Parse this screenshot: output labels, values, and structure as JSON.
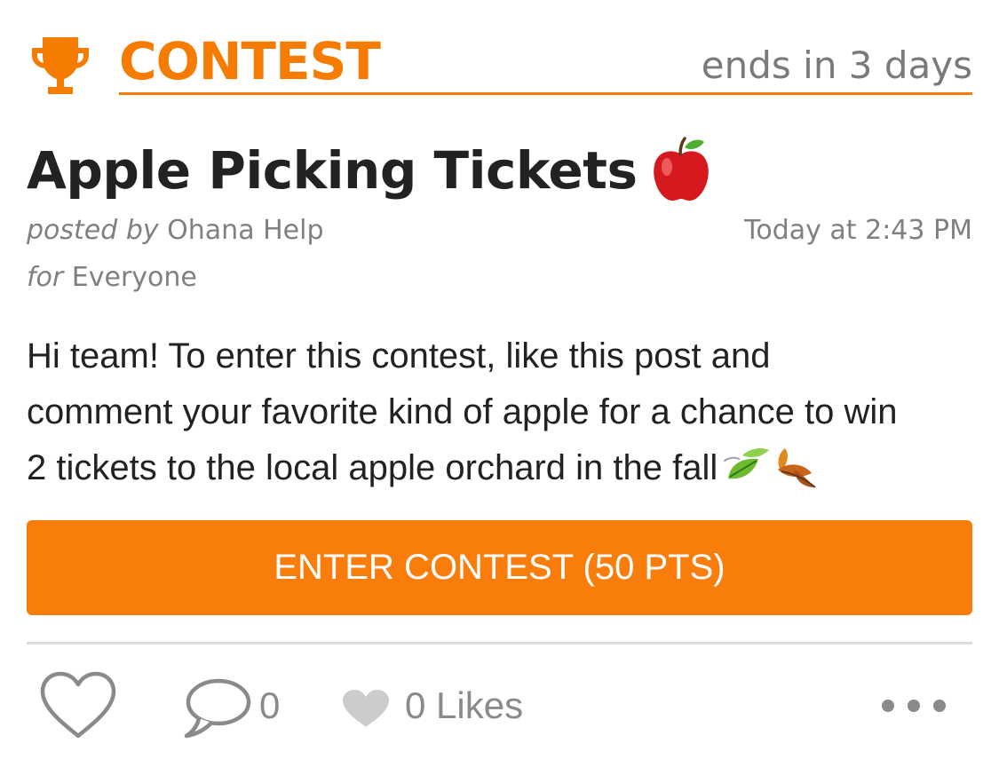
{
  "header": {
    "contest_label": "CONTEST",
    "ends_text": "ends in 3 days",
    "trophy_icon": "trophy-icon"
  },
  "post": {
    "title": "Apple Picking Tickets",
    "title_emoji": "red-apple-emoji",
    "posted_by_label": "posted by",
    "author": "Ohana Help",
    "timestamp": "Today at 2:43 PM",
    "for_label": "for",
    "audience": "Everyone",
    "body_line_1": "Hi team! To enter this contest, like this post and",
    "body_line_2": "comment your favorite kind of apple for a chance to win",
    "body_line_3": "2 tickets to the local apple orchard in the fall",
    "body_emojis": [
      "leaf-fluttering-in-wind-emoji",
      "fallen-leaf-emoji"
    ]
  },
  "cta": {
    "label": "ENTER CONTEST (50 PTS)"
  },
  "actions": {
    "comment_count": "0",
    "likes_label": "0 Likes",
    "icons": [
      "heart-outline-icon",
      "speech-bubble-icon",
      "heart-filled-icon",
      "more-dots-icon"
    ]
  },
  "colors": {
    "accent": "#f57c00",
    "button": "#f97d0b",
    "muted": "#808080",
    "text": "#222222"
  }
}
